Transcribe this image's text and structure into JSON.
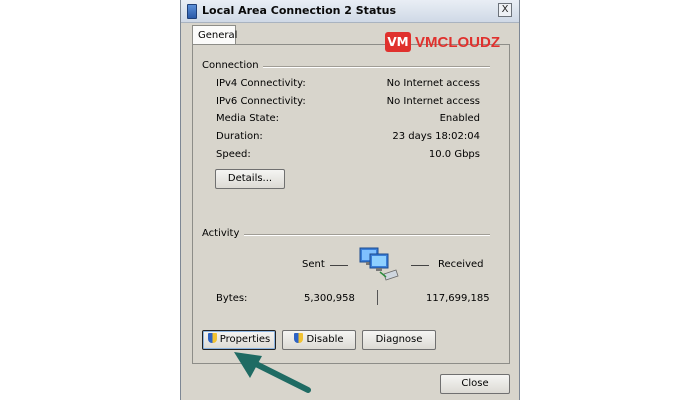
{
  "window": {
    "title": "Local Area Connection 2 Status",
    "close_glyph": "X"
  },
  "tabs": [
    {
      "label": "General"
    }
  ],
  "brand": {
    "mark": "VM",
    "name": "VMCLOUDZ",
    "color": "#e0312d"
  },
  "connection": {
    "heading": "Connection",
    "rows": [
      {
        "label": "IPv4 Connectivity:",
        "value": "No Internet access"
      },
      {
        "label": "IPv6 Connectivity:",
        "value": "No Internet access"
      },
      {
        "label": "Media State:",
        "value": "Enabled"
      },
      {
        "label": "Duration:",
        "value": "23 days 18:02:04"
      },
      {
        "label": "Speed:",
        "value": "10.0 Gbps"
      }
    ],
    "details_button": "Details..."
  },
  "activity": {
    "heading": "Activity",
    "sent_label": "Sent",
    "received_label": "Received",
    "bytes_label": "Bytes:",
    "bytes_sent": "5,300,958",
    "bytes_received": "117,699,185",
    "network_icon": "network-computers-icon"
  },
  "buttons": {
    "properties": "Properties",
    "disable": "Disable",
    "diagnose": "Diagnose",
    "close": "Close"
  },
  "annotation": {
    "arrow_color": "#1f6b63"
  }
}
